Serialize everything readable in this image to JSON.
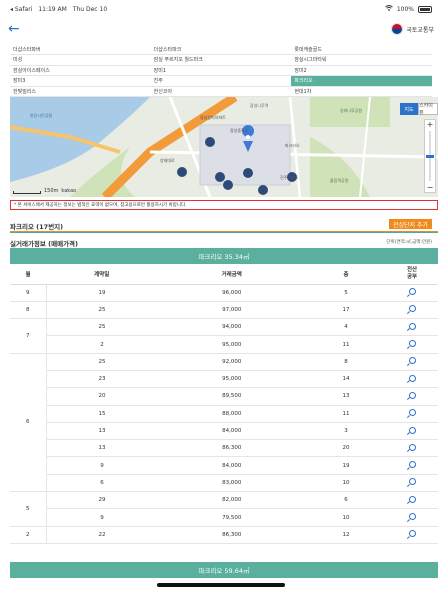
{
  "status_bar": {
    "carrier": "◂ Safari",
    "time": "11:19 AM",
    "date": "Thu Dec 10",
    "battery": "100%"
  },
  "nav": {
    "back_icon": "chevron-left-icon",
    "brand": "국토교통부"
  },
  "regions": [
    [
      "더샵스타파버",
      "더샵스타파크",
      "롯데캐슬골드"
    ],
    [
      "미성",
      "잠실 푸르지오 월드마크",
      "잠실시그마타워"
    ],
    [
      "잠실아이스페이스",
      "장미1",
      "장미2"
    ],
    [
      "장미3",
      "진주",
      "파크리오"
    ],
    [
      "한빛빌리스",
      "한신코아",
      "현대1차"
    ]
  ],
  "selected_region": "파크리오",
  "map": {
    "map_type": "지도",
    "skyview": "스카이뷰",
    "scale": "150m",
    "logo": "kakao",
    "zoom_in": "+",
    "zoom_out": "−",
    "labels": [
      "잠실장미아파트",
      "잠실중학교",
      "파크리오",
      "진주아파트",
      "잠실나루역",
      "한강시민공원",
      "잠실한강공원",
      "올림픽공원",
      "양재대로",
      "송파나루공원"
    ]
  },
  "notice": "* 본 서비스에서 제공하는 정보는 법적인 효력이 없으며, 참고용으로만 활용하시기 바랍니다.",
  "apartment": {
    "title": "파크리오 (17번지)",
    "interest_button": "관심단지 추가"
  },
  "section": {
    "title": "실거래가정보 (매매가격)",
    "unit_note": "단위(면적:㎡,금액:만원)"
  },
  "bands": {
    "top": "파크리오 35.34㎡",
    "bottom": "파크리오 59.64㎡"
  },
  "table": {
    "headers": {
      "month": "월",
      "day": "계약일",
      "price": "거래금액",
      "floor": "층",
      "info": "전산\n공부"
    },
    "rows": [
      {
        "month": "9",
        "day": "19",
        "price": "96,000",
        "floor": "5"
      },
      {
        "month": "8",
        "day": "25",
        "price": "97,000",
        "floor": "17"
      },
      {
        "month": "",
        "day": "25",
        "price": "94,000",
        "floor": "4"
      },
      {
        "month": "7",
        "day": "2",
        "price": "95,000",
        "floor": "11"
      },
      {
        "month": "",
        "day": "25",
        "price": "92,000",
        "floor": "8"
      },
      {
        "month": "",
        "day": "23",
        "price": "95,000",
        "floor": "14"
      },
      {
        "month": "",
        "day": "20",
        "price": "89,500",
        "floor": "13"
      },
      {
        "month": "",
        "day": "15",
        "price": "88,000",
        "floor": "11"
      },
      {
        "month": "6",
        "day": "13",
        "price": "84,000",
        "floor": "3"
      },
      {
        "month": "",
        "day": "13",
        "price": "86,300",
        "floor": "20"
      },
      {
        "month": "",
        "day": "9",
        "price": "84,000",
        "floor": "19"
      },
      {
        "month": "",
        "day": "6",
        "price": "83,000",
        "floor": "10"
      },
      {
        "month": "",
        "day": "29",
        "price": "82,000",
        "floor": "6"
      },
      {
        "month": "5",
        "day": "9",
        "price": "79,500",
        "floor": "10"
      },
      {
        "month": "2",
        "day": "22",
        "price": "86,300",
        "floor": "12"
      }
    ]
  },
  "colors": {
    "accent": "#5ab09d",
    "orange": "#f08a1c",
    "notice_border": "#dd3333",
    "link": "#2b73c8"
  }
}
